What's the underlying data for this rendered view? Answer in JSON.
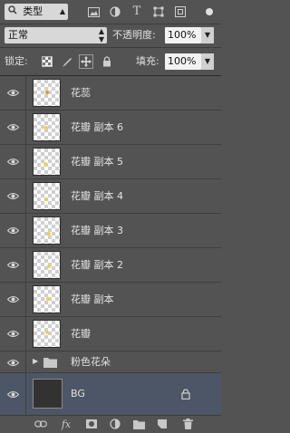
{
  "filter": {
    "kind_label": "类型"
  },
  "mode": {
    "blend_mode": "正常",
    "opacity_label": "不透明度:",
    "opacity_value": "100%"
  },
  "lock": {
    "lock_label": "锁定:",
    "fill_label": "填充:",
    "fill_value": "100%"
  },
  "layers": [
    {
      "name": "花蕊",
      "dot_color": "#d2a21e",
      "visible": true
    },
    {
      "name": "花瓣 副本 6",
      "dot_color": "#ead24e",
      "visible": true
    },
    {
      "name": "花瓣 副本 5",
      "dot_color": "#ead24e",
      "visible": true
    },
    {
      "name": "花瓣 副本 4",
      "dot_color": "#ead24e",
      "visible": true
    },
    {
      "name": "花瓣 副本 3",
      "dot_color": "#ead24e",
      "visible": true
    },
    {
      "name": "花瓣 副本 2",
      "dot_color": "#ead24e",
      "visible": true
    },
    {
      "name": "花瓣 副本",
      "dot_color": "#ead24e",
      "visible": true
    },
    {
      "name": "花瓣",
      "dot_color": "#ead24e",
      "visible": true
    }
  ],
  "group": {
    "name": "粉色花朵"
  },
  "background_layer": {
    "name": "BG",
    "selected": true
  }
}
